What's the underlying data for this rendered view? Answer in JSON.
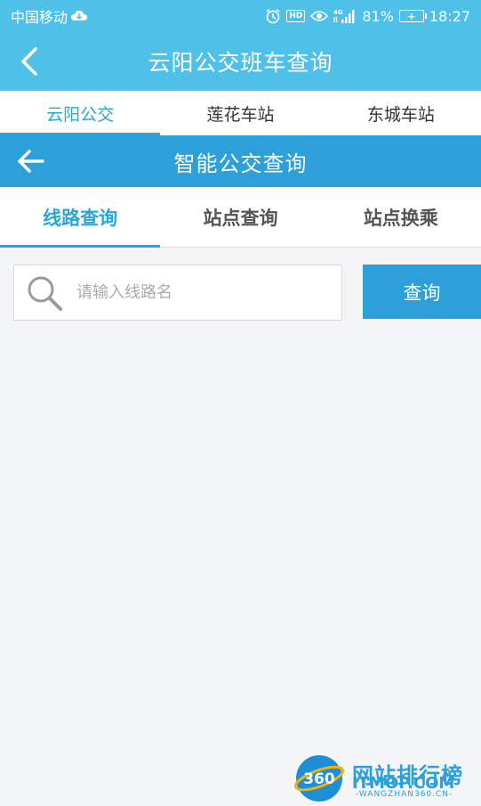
{
  "status_bar": {
    "carrier": "中国移动",
    "network": "4G",
    "battery_percent": "81%",
    "time": "18:27",
    "hd_label": "HD"
  },
  "title_bar": {
    "title": "云阳公交班车查询"
  },
  "top_tabs": [
    {
      "label": "云阳公交",
      "active": true
    },
    {
      "label": "莲花车站",
      "active": false
    },
    {
      "label": "东城车站",
      "active": false
    }
  ],
  "sub_header": {
    "title": "智能公交查询"
  },
  "query_tabs": [
    {
      "label": "线路查询",
      "active": true
    },
    {
      "label": "站点查询",
      "active": false
    },
    {
      "label": "站点换乘",
      "active": false
    }
  ],
  "search": {
    "placeholder": "请输入线路名",
    "value": "",
    "button_label": "查询"
  },
  "watermark": {
    "logo_text": "360",
    "title": "网站排行榜",
    "brand": "ITMOP.COM",
    "url": "-WANGZHAN360.CN-"
  },
  "colors": {
    "header": "#4fc1e9",
    "accent": "#2d9fd9",
    "active_tab": "#2aa6d8"
  }
}
